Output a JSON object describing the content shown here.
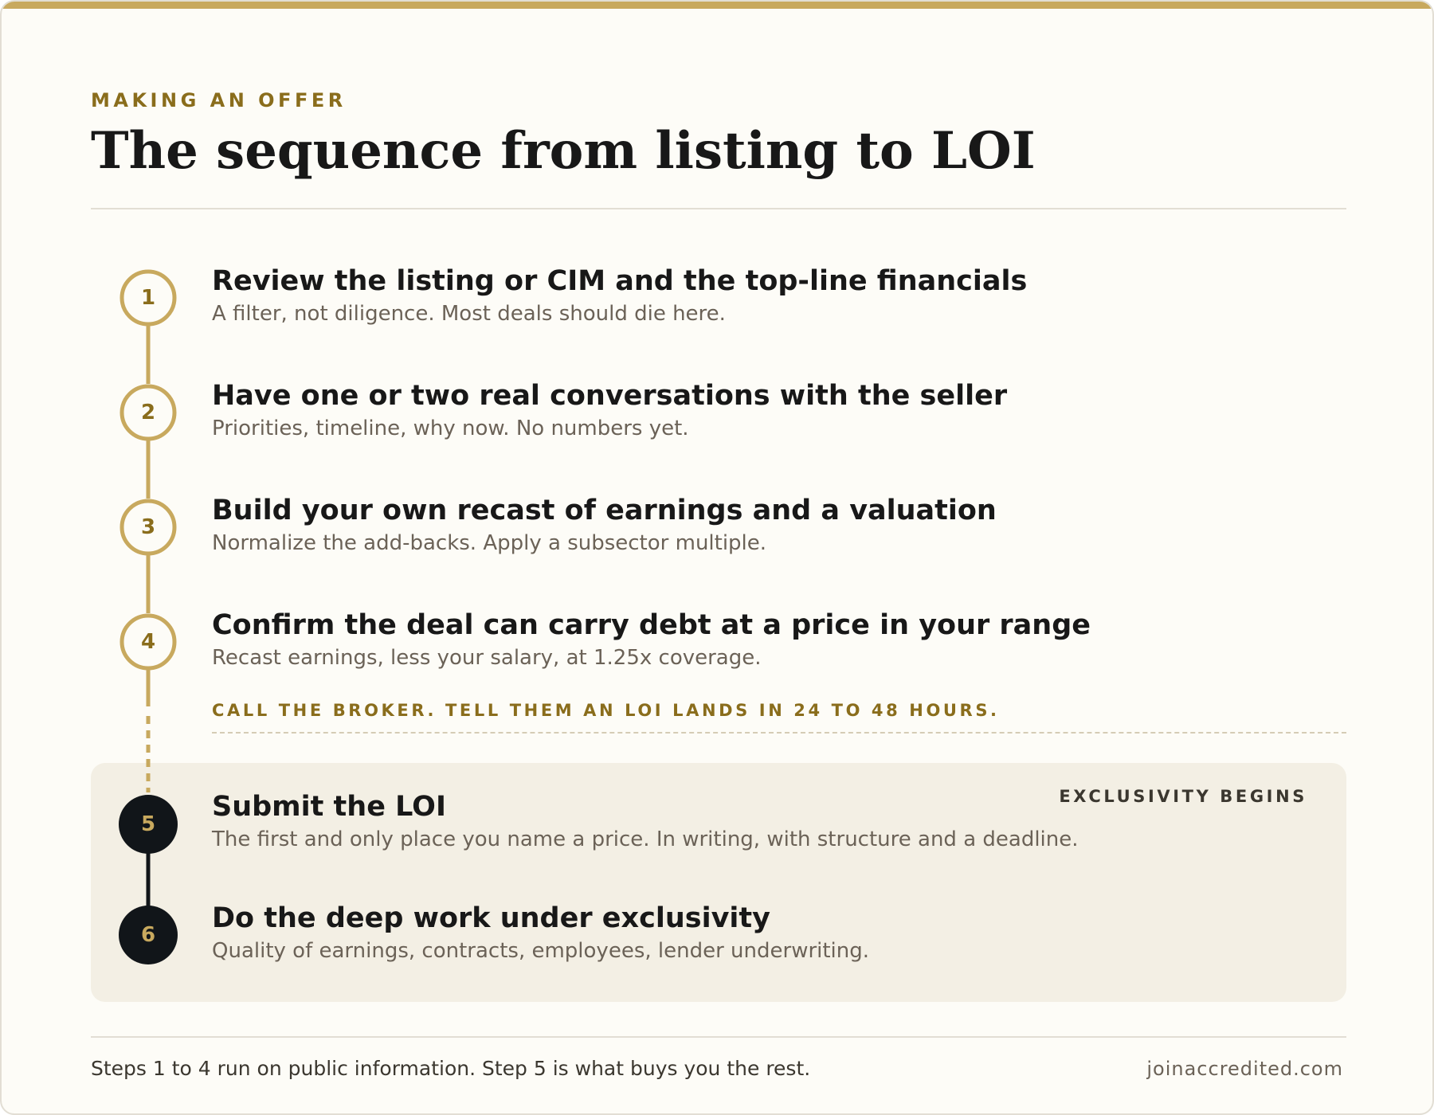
{
  "header": {
    "eyebrow": "MAKING AN OFFER",
    "title": "The sequence from listing to LOI"
  },
  "steps": [
    {
      "number": "1",
      "title": "Review the listing or CIM and the top-line financials",
      "description": "A filter, not diligence. Most deals should die here."
    },
    {
      "number": "2",
      "title": "Have one or two real conversations with the seller",
      "description": "Priorities, timeline, why now. No numbers yet."
    },
    {
      "number": "3",
      "title": "Build your own recast of earnings and a valuation",
      "description": "Normalize the add-backs. Apply a subsector multiple."
    },
    {
      "number": "4",
      "title": "Confirm the deal can carry debt at a price in your range",
      "description": "Recast earnings, less your salary, at 1.25x coverage."
    },
    {
      "number": "5",
      "title": "Submit the LOI",
      "description": "The first and only place you name a price. In writing, with structure and a deadline."
    },
    {
      "number": "6",
      "title": "Do the deep work under exclusivity",
      "description": "Quality of earnings, contracts, employees, lender underwriting."
    }
  ],
  "callout": "CALL THE BROKER. TELL THEM AN LOI LANDS IN 24 TO 48 HOURS.",
  "badge": "EXCLUSIVITY BEGINS",
  "footer": {
    "note": "Steps 1 to 4 run on public information. Step 5 is what buys you the rest.",
    "domain": "joinaccredited.com"
  },
  "colors": {
    "gold": "#c8a95e",
    "gold_text": "#8a6d1c",
    "dark": "#111519",
    "panel": "#f3efe4",
    "background": "#fdfcf7"
  }
}
